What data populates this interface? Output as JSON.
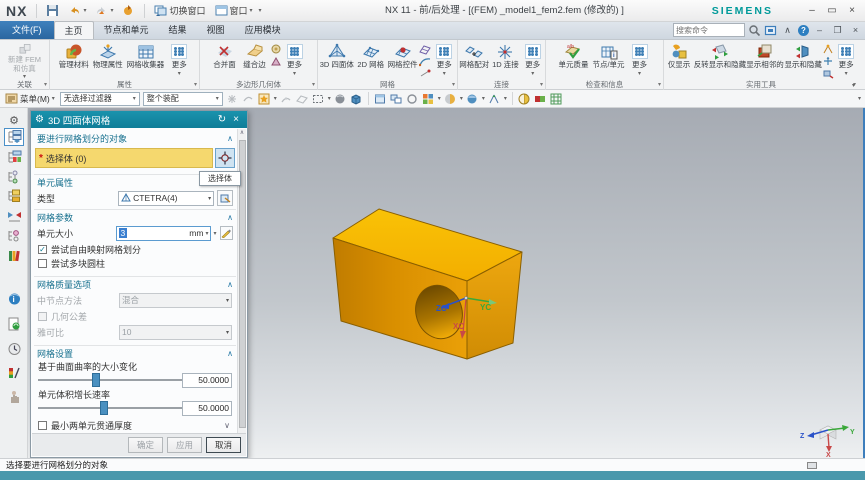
{
  "window": {
    "logo": "NX",
    "title": "NX 11 - 前/后处理 - [(FEM) _model1_fem2.fem  (修改的) ]",
    "brand": "SIEMENS",
    "switch_window": "切换窗口",
    "window_menu": "窗口",
    "search_placeholder": "搜索命令"
  },
  "tabs": {
    "file": "文件(F)",
    "items": [
      "主页",
      "节点和单元",
      "结果",
      "视图",
      "应用模块"
    ],
    "active": "主页"
  },
  "ribbon": {
    "groups": [
      {
        "label": "关联",
        "items": [
          {
            "label": "新建 FEM 和仿真"
          }
        ]
      },
      {
        "label": "属性",
        "items": [
          {
            "label": "管理材料"
          },
          {
            "label": "物理属性"
          },
          {
            "label": "网格收集器"
          },
          {
            "label": "更多"
          }
        ]
      },
      {
        "label": "多边形几何体",
        "items": [
          {
            "label": "合并面"
          },
          {
            "label": "缝合边"
          },
          {
            "label": "更多"
          }
        ]
      },
      {
        "label": "网格",
        "items": [
          {
            "label": "3D 四面体"
          },
          {
            "label": "2D 网格"
          },
          {
            "label": "网格控件"
          },
          {
            "label": "更多"
          }
        ]
      },
      {
        "label": "连接",
        "items": [
          {
            "label": "网格配对"
          },
          {
            "label": "1D 连接"
          },
          {
            "label": "更多"
          }
        ]
      },
      {
        "label": "检查和信息",
        "items": [
          {
            "label": "单元质量"
          },
          {
            "label": "节点/单元"
          },
          {
            "label": "更多"
          }
        ]
      },
      {
        "label": "实用工具",
        "items": [
          {
            "label": "仅显示"
          },
          {
            "label": "反转显示和隐藏"
          },
          {
            "label": "显示相邻的"
          },
          {
            "label": "显示和隐藏"
          },
          {
            "label": "更多"
          }
        ]
      }
    ]
  },
  "toolbar": {
    "menu": "菜单(M)",
    "filter": "无选择过滤器",
    "scope": "整个装配"
  },
  "dialog": {
    "title": "3D 四面体网格",
    "objects": {
      "header": "要进行网格划分的对象",
      "select_body": "选择体 (0)",
      "tooltip": "选择体"
    },
    "element": {
      "header": "单元属性",
      "type_label": "类型",
      "type_value": "CTETRA(4)"
    },
    "params": {
      "header": "网格参数",
      "size_label": "单元大小",
      "size_value": "3",
      "size_unit": "mm",
      "cb_free_mapped": "尝试自由映射网格划分",
      "cb_multi_block": "尝试多块圆柱"
    },
    "quality": {
      "header": "网格质量选项",
      "midnode_label": "中节点方法",
      "midnode_value": "混合",
      "cb_geom_tol": "几何公差",
      "jacobian_label": "雅可比",
      "jacobian_value": "10"
    },
    "settings": {
      "header": "网格设置",
      "curvature_label": "基于曲面曲率的大小变化",
      "curvature_value": "50.0000",
      "curvature_percent": 40,
      "growth_label": "单元体积增长速率",
      "growth_value": "50.0000",
      "growth_percent": 46,
      "cb_min_thickness": "最小两单元贯通厚度"
    },
    "footer": {
      "ok": "确定",
      "apply": "应用",
      "cancel": "取消"
    }
  },
  "viewport": {
    "wcs": {
      "x": "XC",
      "y": "YC",
      "z": "ZC"
    },
    "triad": {
      "x": "X",
      "y": "Y",
      "z": "Z"
    }
  },
  "statusbar": {
    "message": "选择要进行网格划分的对象"
  },
  "icons": {
    "collapse": "∧",
    "expand": "∨",
    "dropdown": "▾",
    "close": "×",
    "reset": "↻",
    "gear": "⚙",
    "check": "✓",
    "minimize": "–",
    "maximize": "❐",
    "restore": "▭",
    "help": "?",
    "star": "✱"
  },
  "colors": {
    "accent_teal": "#1186a3",
    "selection_yellow": "#f5d86e",
    "part_top": "#f6b700",
    "part_front": "#d98f00",
    "part_right": "#e29d0e",
    "bottom_bar": "#4a98ac",
    "file_tab_blue": "#2e73b0",
    "siemens_teal": "#009a9a"
  }
}
